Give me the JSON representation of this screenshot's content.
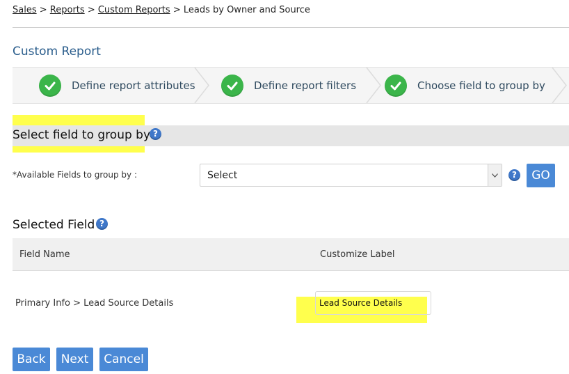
{
  "breadcrumb": {
    "items": [
      "Sales",
      "Reports",
      "Custom Reports"
    ],
    "separator": ">",
    "current": "Leads by Owner and Source"
  },
  "page_title": "Custom Report",
  "steps": [
    {
      "label": "Define report attributes",
      "status": "complete"
    },
    {
      "label": "Define report filters",
      "status": "complete"
    },
    {
      "label": "Choose field to group by",
      "status": "complete"
    }
  ],
  "group_section": {
    "title": "Select field to group by",
    "help_icon": "help-icon"
  },
  "group_field": {
    "label": "*Available Fields to group by :",
    "select_value": "Select",
    "go_label": "GO"
  },
  "selected_section": {
    "title": "Selected Field"
  },
  "table": {
    "headers": [
      "Field Name",
      "Customize Label"
    ],
    "rows": [
      {
        "field_name": "Primary Info > Lead Source Details",
        "custom_label": "Lead Source Details"
      }
    ]
  },
  "buttons": {
    "back": "Back",
    "next": "Next",
    "cancel": "Cancel"
  },
  "colors": {
    "accent": "#4a89d6",
    "title_blue": "#2a5d8c",
    "check_green": "#3bb54a",
    "highlight": "#ffff4d"
  }
}
